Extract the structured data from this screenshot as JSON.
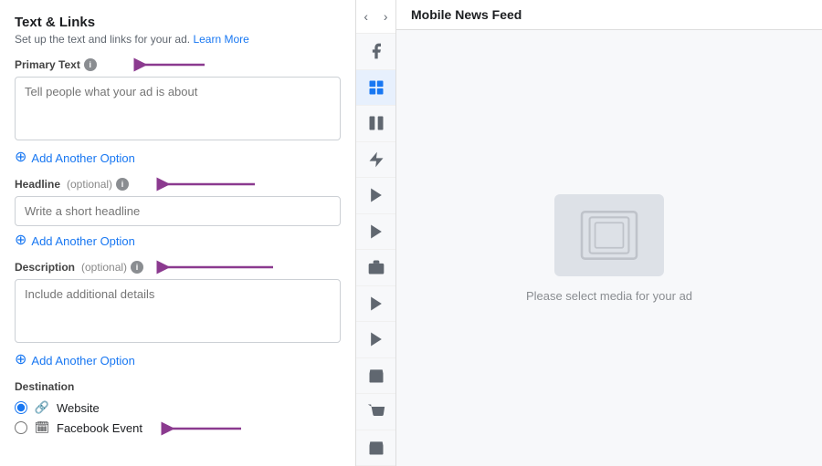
{
  "leftPanel": {
    "title": "Text & Links",
    "subtitle": "Set up the text and links for your ad.",
    "learnMoreLabel": "Learn More",
    "primaryText": {
      "label": "Primary Text",
      "placeholder": "Tell people what your ad is about"
    },
    "headline": {
      "label": "Headline",
      "optionalLabel": "(optional)",
      "placeholder": "Write a short headline"
    },
    "description": {
      "label": "Description",
      "optionalLabel": "(optional)",
      "placeholder": "Include additional details"
    },
    "addAnotherOption1": "Add Another Option",
    "addAnotherOption2": "Add Another Option",
    "addAnotherOption3": "Add Another Option",
    "destination": {
      "label": "Destination",
      "options": [
        {
          "value": "website",
          "label": "Website",
          "selected": true
        },
        {
          "value": "facebook_event",
          "label": "Facebook Event",
          "selected": false
        }
      ]
    }
  },
  "iconBar": {
    "prevLabel": "‹",
    "nextLabel": "›",
    "icons": [
      {
        "name": "facebook-icon",
        "symbol": "f",
        "active": false
      },
      {
        "name": "news-feed-icon",
        "symbol": "▣",
        "active": true
      },
      {
        "name": "column-icon",
        "symbol": "▤",
        "active": false
      },
      {
        "name": "bolt-icon",
        "symbol": "⚡",
        "active": false
      },
      {
        "name": "video-icon-1",
        "symbol": "▶",
        "active": false
      },
      {
        "name": "video-icon-2",
        "symbol": "▶",
        "active": false
      },
      {
        "name": "screen-icon",
        "symbol": "⊟",
        "active": false
      },
      {
        "name": "video-icon-3",
        "symbol": "▶",
        "active": false
      },
      {
        "name": "video-icon-4",
        "symbol": "▶",
        "active": false
      },
      {
        "name": "shop-icon-1",
        "symbol": "🏪",
        "active": false
      },
      {
        "name": "shop-icon-2",
        "symbol": "🏬",
        "active": false
      },
      {
        "name": "more-icon",
        "symbol": "🏪",
        "active": false
      }
    ]
  },
  "rightPanel": {
    "title": "Mobile News Feed",
    "placeholderText": "Please select media for your ad"
  }
}
